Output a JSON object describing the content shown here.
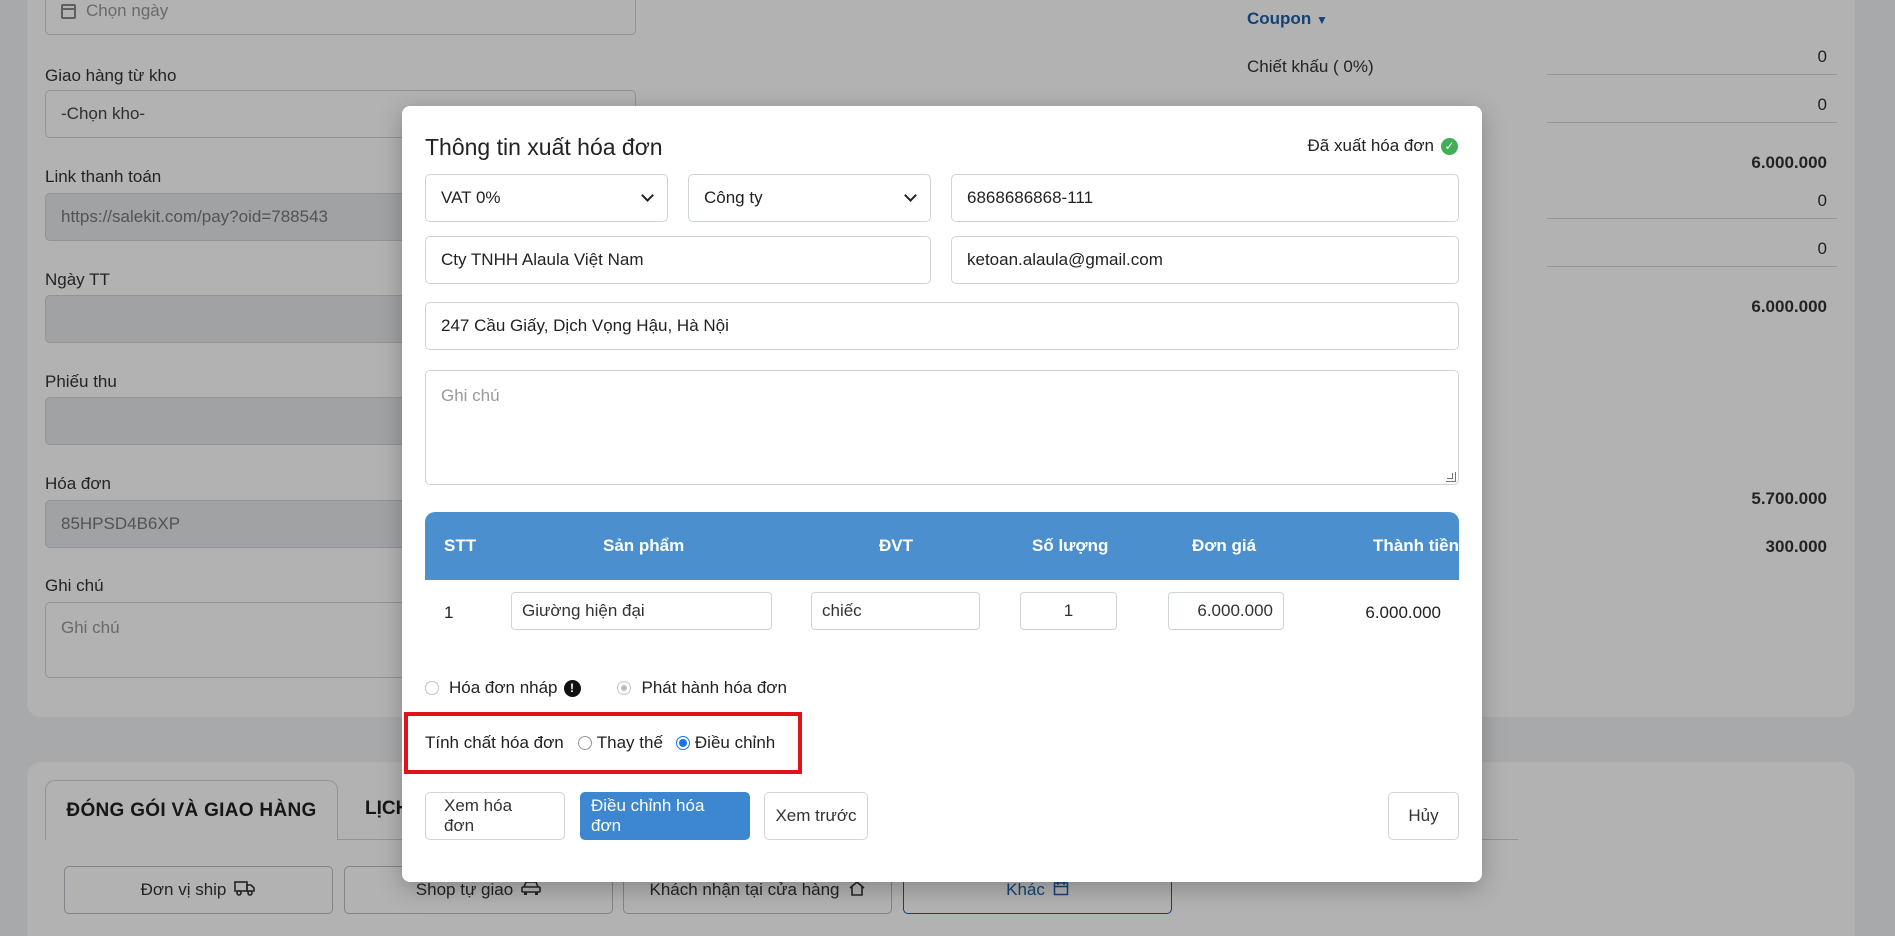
{
  "background": {
    "date_field": {
      "placeholder": "Chọn ngày"
    },
    "warehouse": {
      "label": "Giao hàng từ kho",
      "value": "-Chọn kho-"
    },
    "payment_link": {
      "label": "Link thanh toán",
      "value": "https://salekit.com/pay?oid=788543"
    },
    "payment_date": {
      "label": "Ngày TT",
      "value": ""
    },
    "receipt": {
      "label": "Phiếu thu",
      "value": ""
    },
    "invoice": {
      "label": "Hóa đơn",
      "value": "85HPSD4B6XP"
    },
    "note": {
      "label": "Ghi chú",
      "placeholder": "Ghi chú"
    },
    "summary": {
      "coupon_label": "Coupon",
      "discount_label": "Chiết khấu ( 0%)",
      "values": [
        "0",
        "0",
        "6.000.000",
        "0",
        "0",
        "6.000.000",
        "5.700.000",
        "300.000"
      ]
    },
    "tabs": {
      "active": "ĐÓNG GÓI VÀ GIAO HÀNG",
      "second": "LỊCH"
    },
    "shipping_options": [
      "Đơn vị ship",
      "Shop tự giao",
      "Khách nhận tại cửa hàng",
      "Khác"
    ]
  },
  "modal": {
    "title": "Thông tin xuất hóa đơn",
    "status": "Đã xuất hóa đơn",
    "vat_select": "VAT 0%",
    "customer_type_select": "Công ty",
    "tax_code": "6868686868-111",
    "company_name": "Cty TNHH Alaula Việt Nam",
    "email": "ketoan.alaula@gmail.com",
    "address": "247 Cầu Giấy, Dịch Vọng Hậu, Hà Nội",
    "note_placeholder": "Ghi chú",
    "table": {
      "headers": [
        "STT",
        "Sản phẩm",
        "ĐVT",
        "Số lượng",
        "Đơn giá",
        "Thành tiền"
      ],
      "rows": [
        {
          "stt": "1",
          "product": "Giường hiện đại",
          "unit": "chiếc",
          "qty": "1",
          "price": "6.000.000",
          "total": "6.000.000"
        }
      ]
    },
    "invoice_mode": {
      "draft": "Hóa đơn nháp",
      "issue": "Phát hành hóa đơn"
    },
    "invoice_property": {
      "label": "Tính chất hóa đơn",
      "replace": "Thay thế",
      "adjust": "Điều chỉnh"
    },
    "buttons": {
      "view": "Xem hóa đơn",
      "adjust": "Điều chỉnh hóa đơn",
      "preview": "Xem trước",
      "cancel": "Hủy"
    }
  }
}
